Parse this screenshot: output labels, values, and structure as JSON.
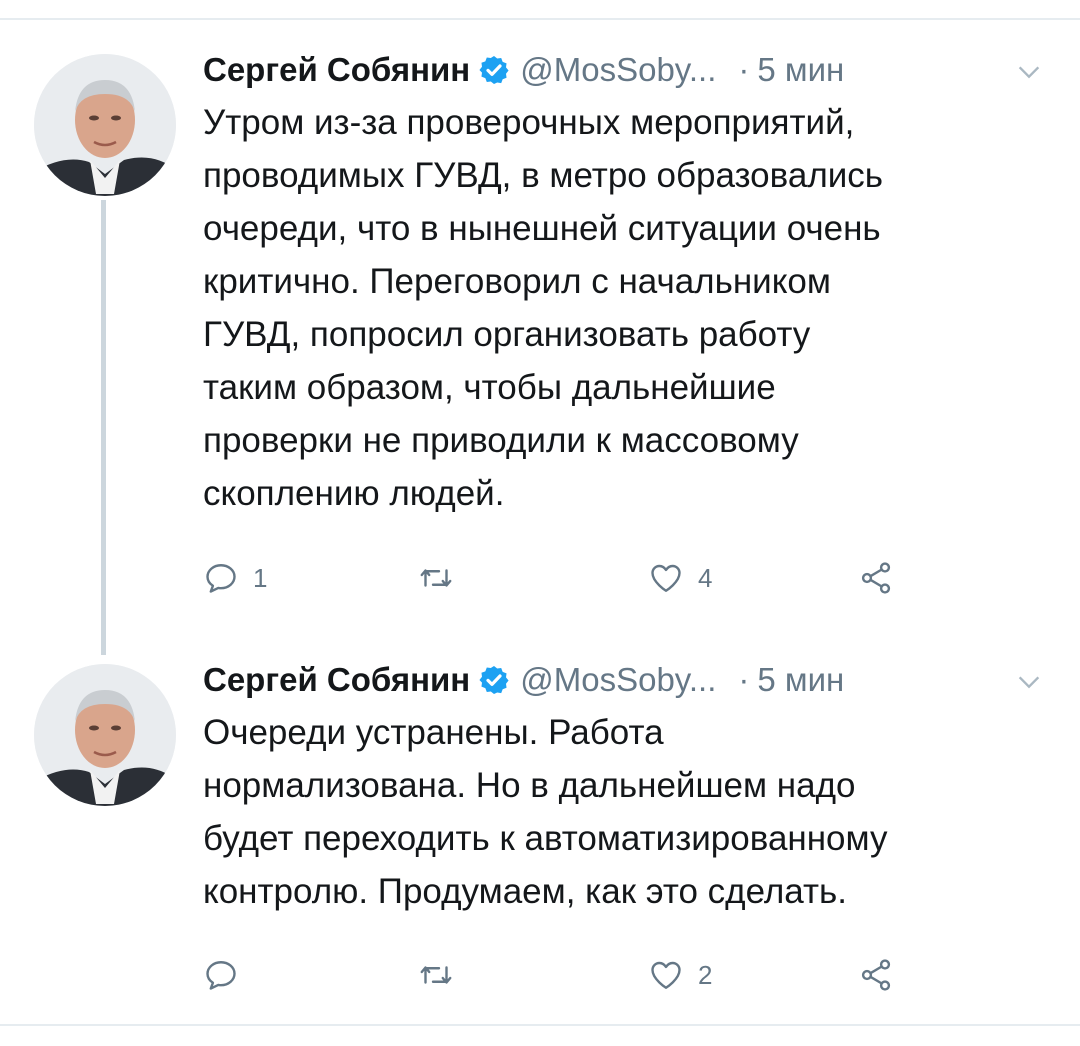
{
  "colors": {
    "text": "#14171a",
    "muted": "#657786",
    "verified": "#1da1f2",
    "thread_line": "#ccd6dd",
    "divider": "#e6ecf0"
  },
  "tweets": [
    {
      "author_name": "Сергей Собянин",
      "handle": "@MosSoby...",
      "separator": "·",
      "time": "5 мин",
      "verified_icon": "verified-badge-icon",
      "text": "Утром из-за проверочных мероприятий, проводимых ГУВД, в метро образовались очереди, что в нынешней ситуации очень критично. Переговорил с начальником ГУВД, попросил организовать работу таким образом, чтобы дальнейшие проверки не приводили к массовому скоплению людей.",
      "lines": [
        "Утром из-за проверочных мероприятий,",
        "проводимых ГУВД, в метро образовались",
        "очереди, что в нынешней ситуации очень",
        "критично. Переговорил с начальником",
        "ГУВД, попросил организовать работу",
        "таким образом, чтобы дальнейшие",
        "проверки не приводили к массовому",
        "скоплению людей."
      ],
      "reply_count": "1",
      "retweet_count": "",
      "like_count": "4"
    },
    {
      "author_name": "Сергей Собянин",
      "handle": "@MosSoby...",
      "separator": "·",
      "time": "5 мин",
      "verified_icon": "verified-badge-icon",
      "text": "Очереди устранены. Работа нормализована. Но в дальнейшем надо будет переходить к автоматизированному контролю. Продумаем, как это сделать.",
      "lines": [
        "Очереди устранены. Работа",
        "нормализована. Но в дальнейшем надо",
        "будет переходить к автоматизированному",
        "контролю. Продумаем, как это сделать."
      ],
      "reply_count": "",
      "retweet_count": "",
      "like_count": "2"
    }
  ]
}
